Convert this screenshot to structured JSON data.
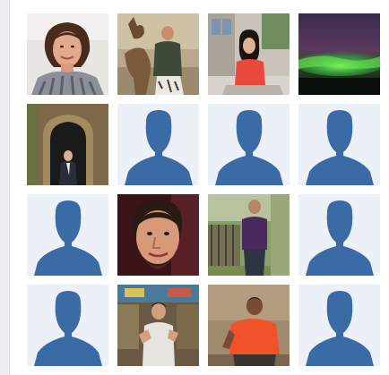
{
  "colors": {
    "silhouette": "#3b6ba4",
    "placeholder_bg": "#ecf0f7",
    "panel_bg": "#ffffff",
    "page_bg": "#eef0f4"
  },
  "grid": {
    "rows": 4,
    "columns": 4,
    "tiles": [
      {
        "kind": "photo",
        "subject": "woman-portrait"
      },
      {
        "kind": "photo",
        "subject": "man-with-animal"
      },
      {
        "kind": "photo",
        "subject": "woman-at-table"
      },
      {
        "kind": "photo",
        "subject": "aurora-landscape"
      },
      {
        "kind": "photo",
        "subject": "person-in-stone-doorway"
      },
      {
        "kind": "default-avatar"
      },
      {
        "kind": "default-avatar"
      },
      {
        "kind": "default-avatar"
      },
      {
        "kind": "default-avatar"
      },
      {
        "kind": "photo",
        "subject": "man-face-closeup"
      },
      {
        "kind": "photo",
        "subject": "man-purple-shirt"
      },
      {
        "kind": "default-avatar"
      },
      {
        "kind": "default-avatar"
      },
      {
        "kind": "photo",
        "subject": "man-in-shop"
      },
      {
        "kind": "photo",
        "subject": "man-red-shirt"
      },
      {
        "kind": "default-avatar"
      }
    ]
  }
}
